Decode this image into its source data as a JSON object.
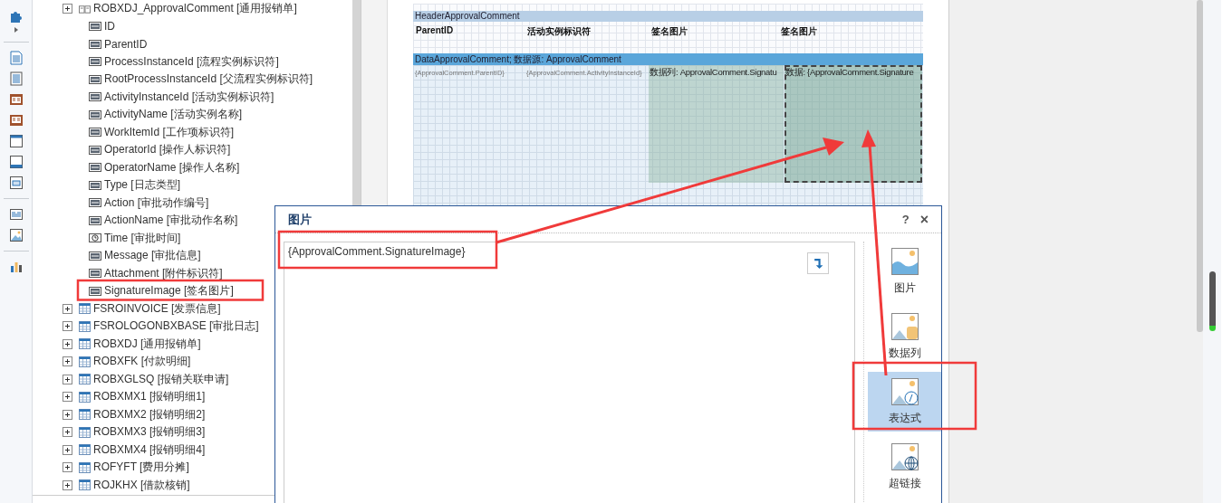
{
  "tree": [
    {
      "label": "ROBXDJ_ApprovalComment [通用报销单]",
      "children": [
        {
          "label": "ID",
          "kind": "text"
        },
        {
          "label": "ParentID",
          "kind": "text"
        },
        {
          "label": "ProcessInstanceId [流程实例标识符]",
          "kind": "text"
        },
        {
          "label": "RootProcessInstanceId [父流程实例标识符]",
          "kind": "text"
        },
        {
          "label": "ActivityInstanceId [活动实例标识符]",
          "kind": "text"
        },
        {
          "label": "ActivityName [活动实例名称]",
          "kind": "text"
        },
        {
          "label": "WorkItemId [工作项标识符]",
          "kind": "text"
        },
        {
          "label": "OperatorId [操作人标识符]",
          "kind": "text"
        },
        {
          "label": "OperatorName [操作人名称]",
          "kind": "text"
        },
        {
          "label": "Type [日志类型]",
          "kind": "text"
        },
        {
          "label": "Action [审批动作编号]",
          "kind": "text"
        },
        {
          "label": "ActionName [审批动作名称]",
          "kind": "text"
        },
        {
          "label": "Time [审批时间]",
          "kind": "time"
        },
        {
          "label": "Message [审批信息]",
          "kind": "text"
        },
        {
          "label": "Attachment [附件标识符]",
          "kind": "text"
        },
        {
          "label": "SignatureImage [签名图片]",
          "kind": "text"
        }
      ]
    },
    {
      "label": "FSROINVOICE [发票信息]"
    },
    {
      "label": "FSROLOGONBXBASE [审批日志]"
    },
    {
      "label": "ROBXDJ [通用报销单]"
    },
    {
      "label": "ROBXFK [付款明细]"
    },
    {
      "label": "ROBXGLSQ [报销关联申请]"
    },
    {
      "label": "ROBXMX1 [报销明细1]"
    },
    {
      "label": "ROBXMX2 [报销明细2]"
    },
    {
      "label": "ROBXMX3 [报销明细3]"
    },
    {
      "label": "ROBXMX4 [报销明细4]"
    },
    {
      "label": "ROFYFT [费用分摊]"
    },
    {
      "label": "ROJKHX [借款核销]"
    }
  ],
  "report": {
    "header_band": "HeaderApprovalComment",
    "header_cells": [
      "ParentID",
      "活动实例标识符",
      "签名图片",
      "签名图片"
    ],
    "data_band": "DataApprovalComment; 数据源: ApprovalComment",
    "data_cells": [
      {
        "text": "{ApprovalComment.ParentID}",
        "kind": "text",
        "selected": false
      },
      {
        "text": "{ApprovalComment.ActivityInstanceId}",
        "kind": "text",
        "selected": false
      },
      {
        "text": "数据列: ApprovalComment.Signatu",
        "kind": "image",
        "selected": false
      },
      {
        "text": "数据: {ApprovalComment.Signature",
        "kind": "image",
        "selected": true
      }
    ]
  },
  "dialog": {
    "title": "图片",
    "help": "?",
    "close": "×",
    "expression": "{ApprovalComment.SignatureImage}",
    "sources": [
      {
        "label": "图片",
        "kind": "image",
        "selected": false
      },
      {
        "label": "数据列",
        "kind": "column",
        "selected": false
      },
      {
        "label": "表达式",
        "kind": "expression",
        "selected": true
      },
      {
        "label": "超链接",
        "kind": "link",
        "selected": false
      }
    ]
  }
}
